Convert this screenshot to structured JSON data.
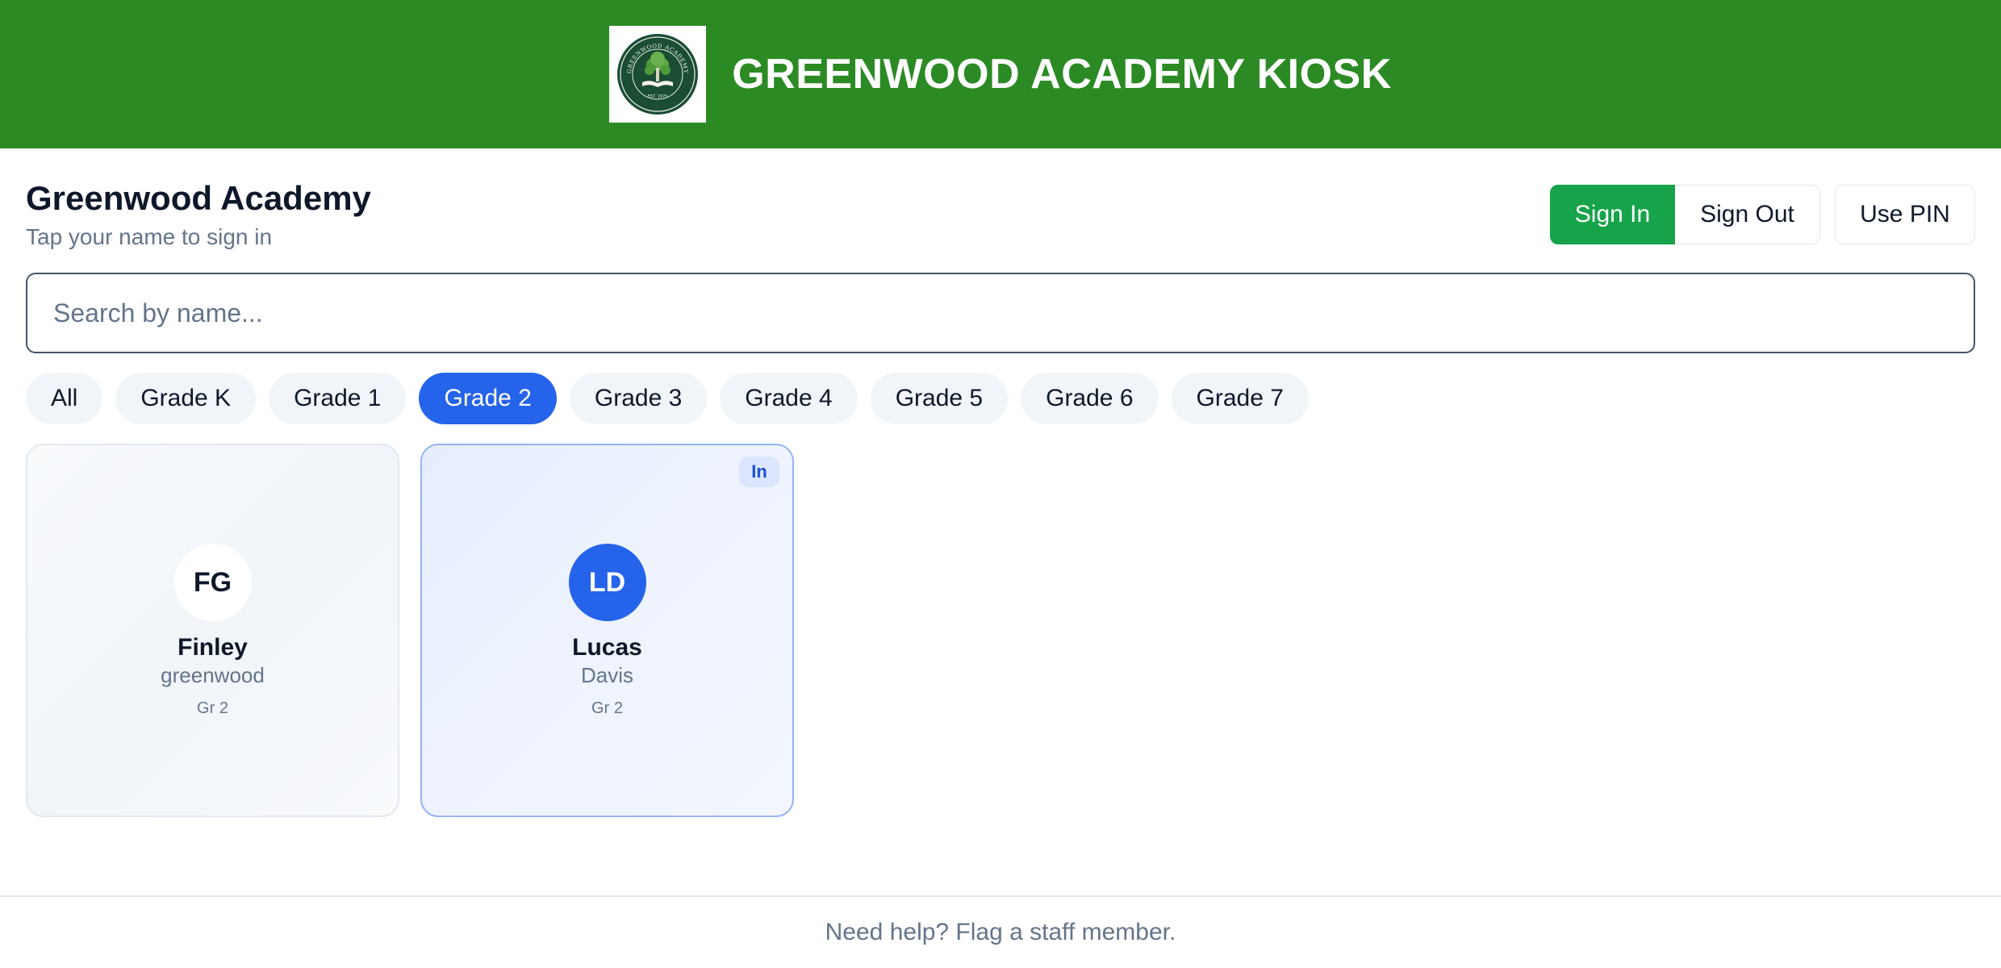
{
  "header": {
    "title": "GREENWOOD ACADEMY KIOSK",
    "logo": {
      "icon": "tree-crest-icon",
      "ring_text": "GREENWOOD ACADEMY",
      "est_text": "EST. 1970"
    }
  },
  "school": {
    "name": "Greenwood Academy",
    "subtitle": "Tap your name to sign in"
  },
  "actions": {
    "sign_in": "Sign In",
    "sign_out": "Sign Out",
    "use_pin": "Use PIN",
    "mode": "sign_in"
  },
  "search": {
    "placeholder": "Search by name...",
    "value": ""
  },
  "filters": [
    "All",
    "Grade K",
    "Grade 1",
    "Grade 2",
    "Grade 3",
    "Grade 4",
    "Grade 5",
    "Grade 6",
    "Grade 7"
  ],
  "selected_filter": "Grade 2",
  "students": [
    {
      "initials": "FG",
      "first": "Finley",
      "last": "greenwood",
      "grade": "Gr 2",
      "status": ""
    },
    {
      "initials": "LD",
      "first": "Lucas",
      "last": "Davis",
      "grade": "Gr 2",
      "status": "In"
    }
  ],
  "footer": {
    "text": "Need help? Flag a staff member."
  },
  "colors": {
    "header": "#2b8a24",
    "sign_in": "#16a34a",
    "accent": "#2563eb",
    "muted": "#64748b"
  }
}
